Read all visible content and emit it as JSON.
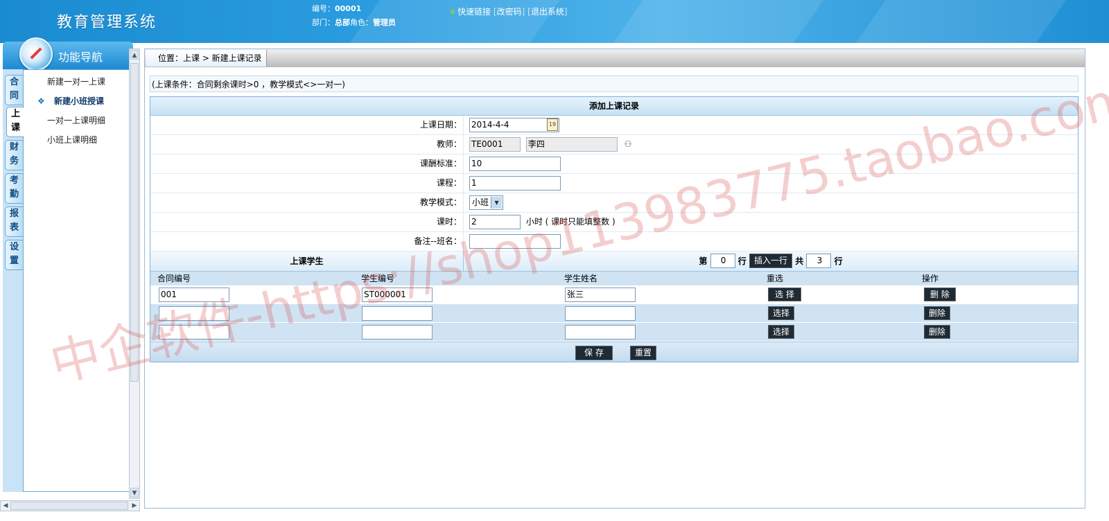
{
  "header": {
    "app_title": "教育管理系统",
    "user_no_label": "编号：",
    "user_no": "00001",
    "dept_label": "部门：",
    "dept": "总部",
    "role_label": "角色：",
    "role": "管理员",
    "quick_links_label": "快速链接",
    "change_password": "改密码",
    "logout": "退出系统"
  },
  "sidebar": {
    "title": "功能导航",
    "tabs": [
      {
        "label": "合同"
      },
      {
        "label": "上课"
      },
      {
        "label": "财务"
      },
      {
        "label": "考勤"
      },
      {
        "label": "报表"
      },
      {
        "label": "设置"
      }
    ],
    "active_tab": "上课",
    "items": [
      {
        "label": "新建一对一上课"
      },
      {
        "label": "新建小班授课"
      },
      {
        "label": "一对一上课明细"
      },
      {
        "label": "小班上课明细"
      }
    ],
    "active_item": "新建小班授课"
  },
  "breadcrumb": "位置：上课 > 新建上课记录",
  "condition_note": "(上课条件：合同剩余课时>0 ，教学模式<>一对一)",
  "form": {
    "title": "添加上课记录",
    "date_label": "上课日期：",
    "date_value": "2014-4-4",
    "teacher_label": "教师：",
    "teacher_id": "TE0001",
    "teacher_name": "李四",
    "pay_label": "课酬标准：",
    "pay_value": "10",
    "course_label": "课程：",
    "course_value": "1",
    "mode_label": "教学模式：",
    "mode_value": "小班",
    "hours_label": "课时：",
    "hours_value": "2",
    "hours_hint": "小时 ( 课时只能填整数 )",
    "note_label": "备注--班名：",
    "note_value": ""
  },
  "students": {
    "section_title": "上课学生",
    "row_prefix": "第",
    "row_index": "0",
    "row_suffix": "行",
    "insert_button": "插入一行",
    "total_prefix": "共",
    "total_rows": "3",
    "total_suffix": "行",
    "columns": [
      "合同编号",
      "学生编号",
      "学生姓名",
      "重选",
      "操作"
    ],
    "rows": [
      {
        "contract_no": "001",
        "student_no": "ST000001",
        "student_name": "张三",
        "select_label": "选 择",
        "delete_label": "删 除"
      },
      {
        "contract_no": "",
        "student_no": "",
        "student_name": "",
        "select_label": "选择",
        "delete_label": "删除"
      },
      {
        "contract_no": "",
        "student_no": "",
        "student_name": "",
        "select_label": "选择",
        "delete_label": "删除"
      }
    ]
  },
  "actions": {
    "save": "保 存",
    "reset": "重置"
  },
  "watermark": "中企软件-https://shop113983775.taobao.com"
}
